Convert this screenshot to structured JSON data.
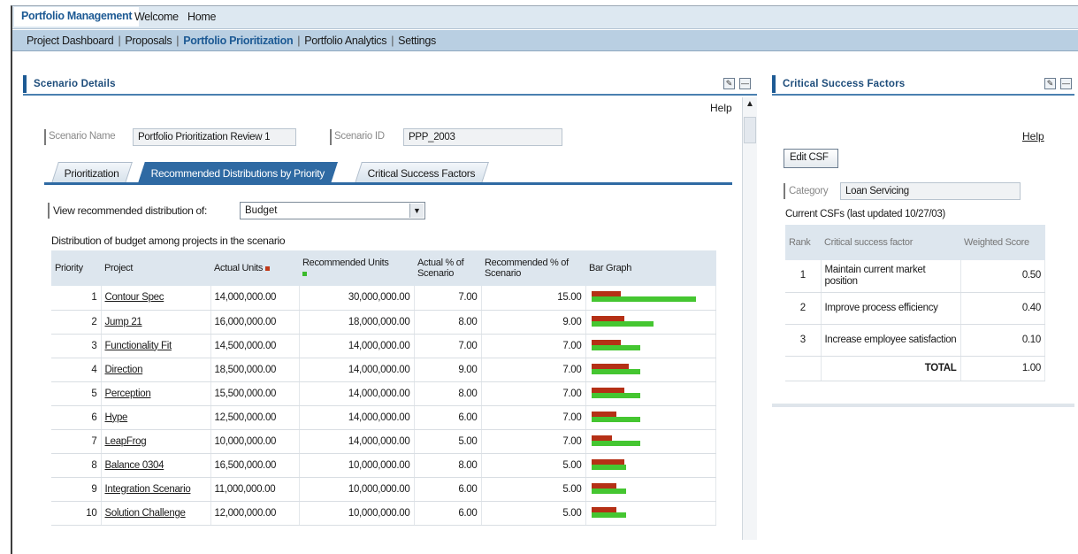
{
  "topnav": {
    "tabs": [
      "Portfolio Management",
      "Welcome",
      "Home"
    ]
  },
  "subnav": {
    "items": [
      "Project Dashboard",
      "Proposals",
      "Portfolio Prioritization",
      "Portfolio Analytics",
      "Settings"
    ],
    "active": "Portfolio Prioritization"
  },
  "scenario_panel": {
    "title": "Scenario Details",
    "help": "Help",
    "scenario_name_label": "Scenario Name",
    "scenario_name_value": "Portfolio Prioritization Review 1",
    "scenario_id_label": "Scenario ID",
    "scenario_id_value": "PPP_2003",
    "tabs": [
      "Prioritization",
      "Recommended Distributions by Priority",
      "Critical Success Factors"
    ],
    "active_tab": "Recommended Distributions by Priority",
    "view_label": "View recommended distribution of:",
    "view_value": "Budget",
    "caption": "Distribution of budget among projects in the scenario",
    "columns": [
      "Priority",
      "Project",
      "Actual Units",
      "Recommended Units",
      "Actual % of Scenario",
      "Recommended % of Scenario",
      "Bar Graph"
    ],
    "rows": [
      {
        "priority": "1",
        "project": "Contour Spec",
        "actual": "14,000,000.00",
        "recommended": "30,000,000.00",
        "actual_pct": "7.00",
        "rec_pct": "15.00"
      },
      {
        "priority": "2",
        "project": "Jump 21",
        "actual": "16,000,000.00",
        "recommended": "18,000,000.00",
        "actual_pct": "8.00",
        "rec_pct": "9.00"
      },
      {
        "priority": "3",
        "project": "Functionality Fit",
        "actual": "14,500,000.00",
        "recommended": "14,000,000.00",
        "actual_pct": "7.00",
        "rec_pct": "7.00"
      },
      {
        "priority": "4",
        "project": "Direction",
        "actual": "18,500,000.00",
        "recommended": "14,000,000.00",
        "actual_pct": "9.00",
        "rec_pct": "7.00"
      },
      {
        "priority": "5",
        "project": "Perception",
        "actual": "15,500,000.00",
        "recommended": "14,000,000.00",
        "actual_pct": "8.00",
        "rec_pct": "7.00"
      },
      {
        "priority": "6",
        "project": "Hype",
        "actual": "12,500,000.00",
        "recommended": "14,000,000.00",
        "actual_pct": "6.00",
        "rec_pct": "7.00"
      },
      {
        "priority": "7",
        "project": "LeapFrog",
        "actual": "10,000,000.00",
        "recommended": "14,000,000.00",
        "actual_pct": "5.00",
        "rec_pct": "7.00"
      },
      {
        "priority": "8",
        "project": "Balance 0304",
        "actual": "16,500,000.00",
        "recommended": "10,000,000.00",
        "actual_pct": "8.00",
        "rec_pct": "5.00"
      },
      {
        "priority": "9",
        "project": "Integration Scenario",
        "actual": "11,000,000.00",
        "recommended": "10,000,000.00",
        "actual_pct": "6.00",
        "rec_pct": "5.00"
      },
      {
        "priority": "10",
        "project": "Solution Challenge",
        "actual": "12,000,000.00",
        "recommended": "10,000,000.00",
        "actual_pct": "6.00",
        "rec_pct": "5.00"
      }
    ]
  },
  "csf_panel": {
    "title": "Critical Success Factors",
    "help": "Help",
    "edit_button": "Edit CSF",
    "category_label": "Category",
    "category_value": "Loan Servicing",
    "updated": "Current CSFs (last updated 10/27/03)",
    "columns": [
      "Rank",
      "Critical success factor",
      "Weighted Score"
    ],
    "rows": [
      {
        "rank": "1",
        "factor": "Maintain current market position",
        "score": "0.50"
      },
      {
        "rank": "2",
        "factor": "Improve process efficiency",
        "score": "0.40"
      },
      {
        "rank": "3",
        "factor": "Increase employee satisfaction",
        "score": "0.10"
      }
    ],
    "total_label": "TOTAL",
    "total_value": "1.00"
  },
  "colors": {
    "actual_bar": "#b53016",
    "recommended_bar": "#45c631",
    "accent": "#1d5a94"
  }
}
